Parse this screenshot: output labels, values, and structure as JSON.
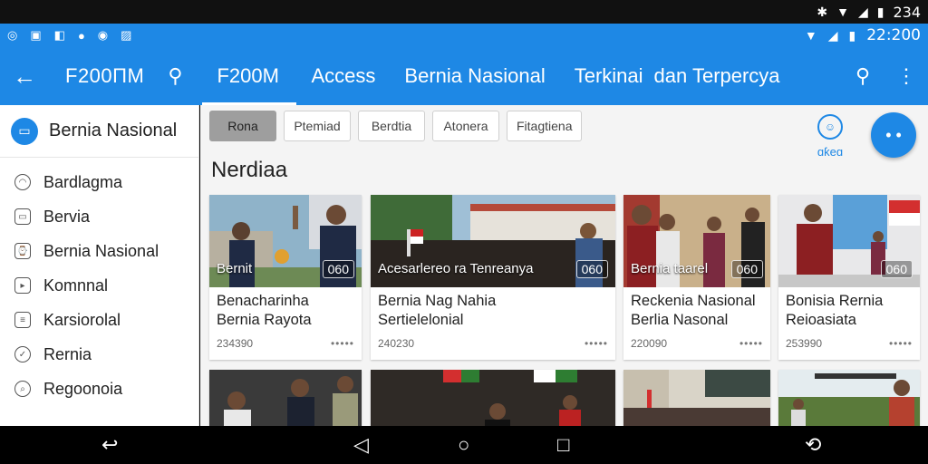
{
  "system_top": {
    "time": "234"
  },
  "status_bar": {
    "time": "22:200"
  },
  "app_bar": {
    "title": "F200ΠM",
    "tabs": [
      "F200M",
      "Access",
      "Bernia Nasional",
      "Terkinai",
      "dan Terpercya"
    ]
  },
  "drawer": {
    "header": "Bernia Nasional",
    "items": [
      {
        "label": "Bardlagma",
        "icon": "compass-icon"
      },
      {
        "label": "Bervia",
        "icon": "tv-icon"
      },
      {
        "label": "Bernia Nasional",
        "icon": "clock-icon"
      },
      {
        "label": "Komnnal",
        "icon": "message-icon"
      },
      {
        "label": "Karsiorolal",
        "icon": "list-icon"
      },
      {
        "label": "Rernia",
        "icon": "check-circle-icon"
      },
      {
        "label": "Regoonoia",
        "icon": "search-circle-icon"
      }
    ]
  },
  "main": {
    "chips": [
      "Rona",
      "Ptemiad",
      "Berdtia",
      "Atonera",
      "Fitagtiena"
    ],
    "profile_label": "ɑƙeɑ",
    "section_title": "Nerdiaa",
    "cards": [
      {
        "caption": "Bernit",
        "duration": "060",
        "title": "Benacharinha\nBernia Rayota",
        "meta": "234390"
      },
      {
        "caption": "Acesarlereo ra Tenreanya",
        "duration": "060",
        "title": "Bernia Nag Nahia\nSertielelonial",
        "meta": "240230"
      },
      {
        "caption": "Bernia taarel",
        "duration": "060",
        "title": "Reckenia Nasional\nBerlia Nasonal",
        "meta": "220090"
      },
      {
        "caption": "",
        "duration": "060",
        "title": "Bonisia Rernia\nReioasiata",
        "meta": "253990"
      },
      {
        "caption": "",
        "duration": "",
        "title": "",
        "meta": ""
      },
      {
        "caption": "",
        "duration": "",
        "title": "",
        "meta": ""
      },
      {
        "caption": "",
        "duration": "",
        "title": "",
        "meta": ""
      },
      {
        "caption": "",
        "duration": "",
        "title": "",
        "meta": ""
      }
    ]
  },
  "colors": {
    "primary": "#1e88e5",
    "system_bar": "#111111"
  }
}
